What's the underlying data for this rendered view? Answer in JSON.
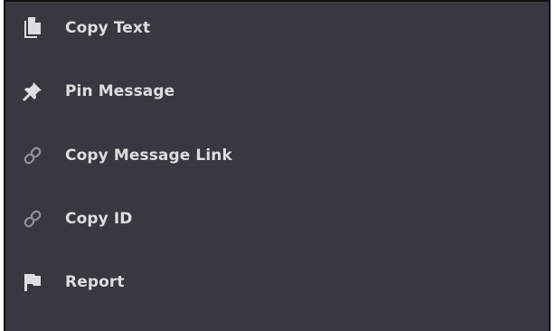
{
  "context_menu": {
    "items": [
      {
        "label": "Copy Text",
        "icon": "copy-icon"
      },
      {
        "label": "Pin Message",
        "icon": "pin-icon"
      },
      {
        "label": "Copy Message Link",
        "icon": "link-icon"
      },
      {
        "label": "Copy ID",
        "icon": "link-icon"
      },
      {
        "label": "Report",
        "icon": "flag-icon"
      }
    ]
  },
  "colors": {
    "menu_background": "#36393f",
    "text": "#dcddde",
    "icon_bright": "#dcddde",
    "icon_muted": "#8e9297"
  }
}
